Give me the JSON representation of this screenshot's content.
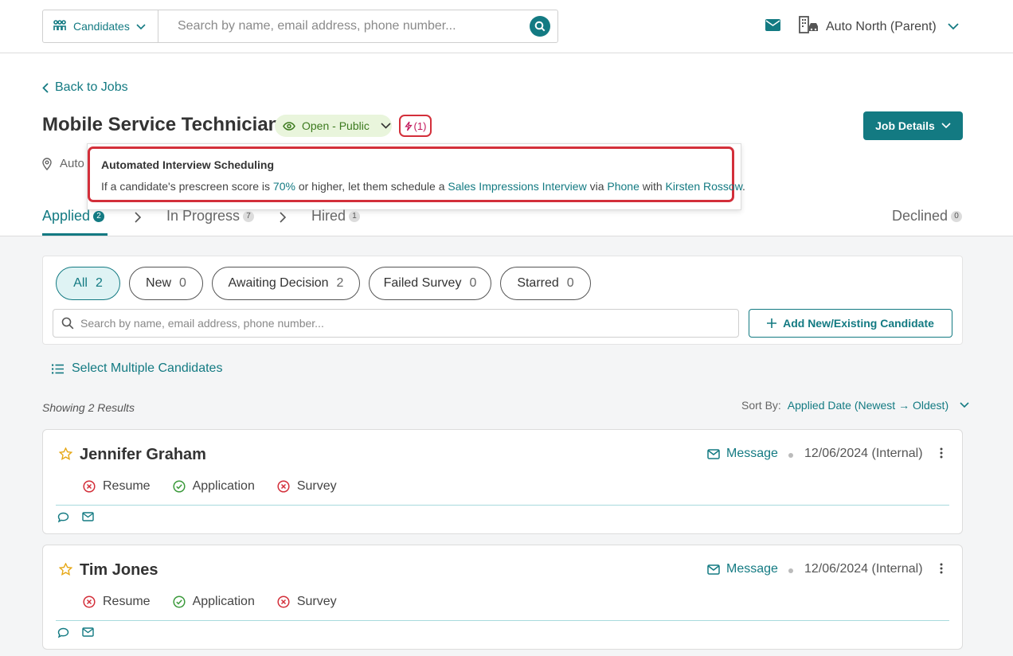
{
  "header": {
    "category_label": "Candidates",
    "search_placeholder": "Search by name, email address, phone number...",
    "org_name": "Auto North (Parent)"
  },
  "job": {
    "back_label": "Back to Jobs",
    "title": "Mobile Service Technician",
    "status": "Open - Public",
    "automation_count": "(1)",
    "details_button": "Job Details",
    "location_partial": "Auto"
  },
  "tooltip": {
    "title": "Automated Interview Scheduling",
    "t1": "If a candidate's prescreen score is ",
    "score": "70%",
    "t2": " or higher, let them schedule a ",
    "interview": "Sales Impressions Interview",
    "t3": " via ",
    "method": "Phone",
    "t4": " with ",
    "interviewer": "Kirsten Rossow",
    "t5": "."
  },
  "tabs": [
    {
      "label": "Applied",
      "count": "2"
    },
    {
      "label": "In Progress",
      "count": "7"
    },
    {
      "label": "Hired",
      "count": "1"
    },
    {
      "label": "Declined",
      "count": "0"
    }
  ],
  "filters": [
    {
      "label": "All",
      "count": "2"
    },
    {
      "label": "New",
      "count": "0"
    },
    {
      "label": "Awaiting Decision",
      "count": "2"
    },
    {
      "label": "Failed Survey",
      "count": "0"
    },
    {
      "label": "Starred",
      "count": "0"
    }
  ],
  "list": {
    "search_placeholder": "Search by name, email address, phone number...",
    "add_button": "Add New/Existing Candidate",
    "select_multiple": "Select Multiple Candidates",
    "showing": "Showing 2 Results",
    "sort_label": "Sort By:",
    "sort_value": "Applied Date (Newest → Oldest)"
  },
  "candidates": [
    {
      "name": "Jennifer Graham",
      "message": "Message",
      "date": "12/06/2024 (Internal)",
      "docs": [
        "Resume",
        "Application",
        "Survey"
      ]
    },
    {
      "name": "Tim Jones",
      "message": "Message",
      "date": "12/06/2024 (Internal)",
      "docs": [
        "Resume",
        "Application",
        "Survey"
      ]
    }
  ],
  "colors": {
    "accent": "#137a82",
    "highlight": "#d32f3a",
    "success": "#3c9a3c",
    "error": "#d32f3a",
    "star": "#e6a817"
  }
}
